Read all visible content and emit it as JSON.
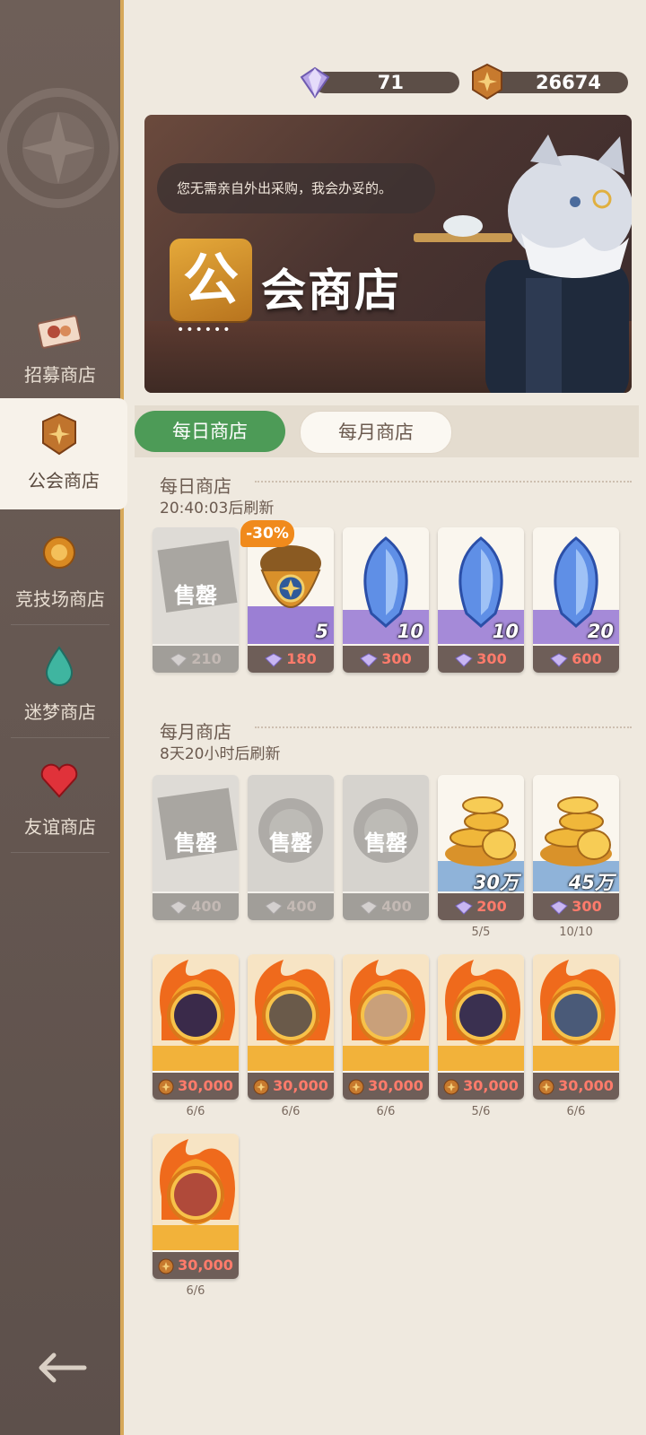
{
  "currency": {
    "gems": "71",
    "guild_coins": "26674"
  },
  "sidebar": {
    "items": [
      {
        "label": "招募商店",
        "icon": "recruit-ticket-icon"
      },
      {
        "label": "公会商店",
        "icon": "guild-emblem-icon"
      },
      {
        "label": "竞技场商店",
        "icon": "arena-medal-icon"
      },
      {
        "label": "迷梦商店",
        "icon": "dream-drop-icon"
      },
      {
        "label": "友谊商店",
        "icon": "heart-icon"
      }
    ],
    "active_index": 1
  },
  "banner": {
    "speech": "您无需亲自外出采购，我会办妥的。",
    "badge_char": "公",
    "title": "会商店",
    "dots": "••••••"
  },
  "tabs": [
    {
      "label": "每日商店"
    },
    {
      "label": "每月商店"
    }
  ],
  "daily": {
    "title": "每日商店",
    "refresh": "20:40:03后刷新",
    "items": [
      {
        "sold": true,
        "sold_text": "售罄",
        "price": "210",
        "currency": "gem"
      },
      {
        "sold": false,
        "discount": "-30%",
        "qty": "5",
        "price": "180",
        "currency": "gem"
      },
      {
        "sold": false,
        "qty": "10",
        "price": "300",
        "currency": "gem"
      },
      {
        "sold": false,
        "qty": "10",
        "price": "300",
        "currency": "gem"
      },
      {
        "sold": false,
        "qty": "20",
        "price": "600",
        "currency": "gem"
      }
    ]
  },
  "monthly": {
    "title": "每月商店",
    "refresh": "8天20小时后刷新",
    "row1": [
      {
        "sold": true,
        "sold_text": "售罄",
        "price": "400",
        "currency": "gem"
      },
      {
        "sold": true,
        "sold_text": "售罄",
        "price": "400",
        "currency": "gem"
      },
      {
        "sold": true,
        "sold_text": "售罄",
        "price": "400",
        "currency": "gem"
      },
      {
        "sold": false,
        "qty": "30万",
        "price": "200",
        "currency": "gem",
        "limit": "5/5"
      },
      {
        "sold": false,
        "qty": "45万",
        "price": "300",
        "currency": "gem",
        "limit": "10/10"
      }
    ],
    "row2": [
      {
        "price": "30,000",
        "currency": "coin",
        "limit": "6/6"
      },
      {
        "price": "30,000",
        "currency": "coin",
        "limit": "6/6"
      },
      {
        "price": "30,000",
        "currency": "coin",
        "limit": "6/6"
      },
      {
        "price": "30,000",
        "currency": "coin",
        "limit": "5/6"
      },
      {
        "price": "30,000",
        "currency": "coin",
        "limit": "6/6"
      }
    ],
    "row3": [
      {
        "price": "30,000",
        "currency": "coin",
        "limit": "6/6"
      }
    ]
  },
  "colors": {
    "accent_green": "#4d9b57",
    "price_red": "#ff7b6b",
    "sidebar": "#5d504b",
    "gold_border": "#d6a85a"
  }
}
